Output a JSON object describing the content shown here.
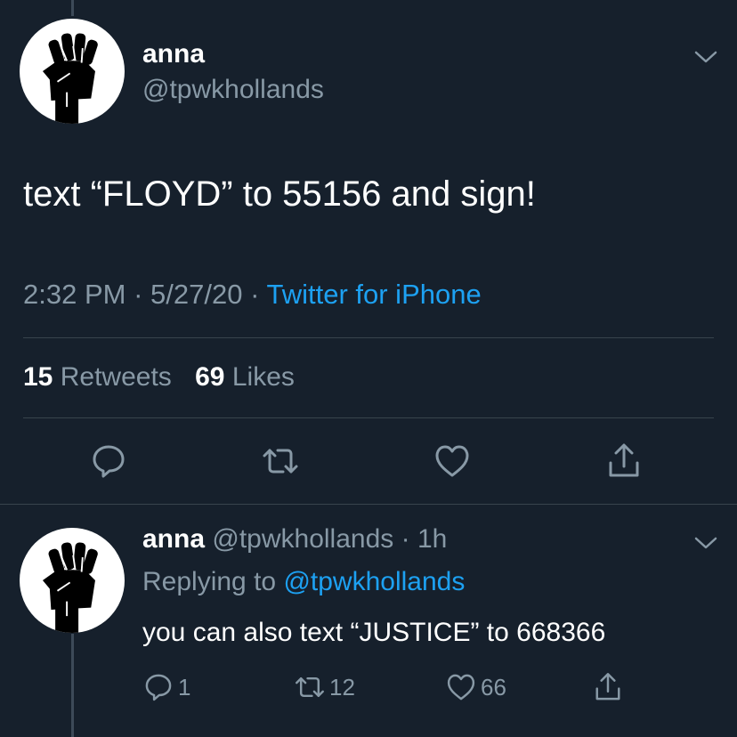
{
  "tweet": {
    "author_name": "anna",
    "author_handle": "@tpwkhollands",
    "avatar_icon": "raised-fist-icon",
    "text": "text “FLOYD” to 55156 and sign!",
    "time": "2:32 PM",
    "date": "5/27/20",
    "separator": "·",
    "source": "Twitter for iPhone",
    "retweets_count": "15",
    "retweets_label": "Retweets",
    "likes_count": "69",
    "likes_label": "Likes",
    "actions": [
      "reply-icon",
      "retweet-icon",
      "like-icon",
      "share-icon"
    ]
  },
  "reply": {
    "author_name": "anna",
    "author_handle": "@tpwkhollands",
    "separator": "·",
    "age": "1h",
    "avatar_icon": "raised-fist-icon",
    "replying_label": "Replying to",
    "replying_to": "@tpwkhollands",
    "text": "you can also text “JUSTICE” to 668366",
    "reply_count": "1",
    "retweet_count": "12",
    "like_count": "66"
  },
  "colors": {
    "background": "#16202c",
    "accent": "#1da1f2",
    "secondary_text": "#8899a6",
    "divider": "#38444d"
  }
}
